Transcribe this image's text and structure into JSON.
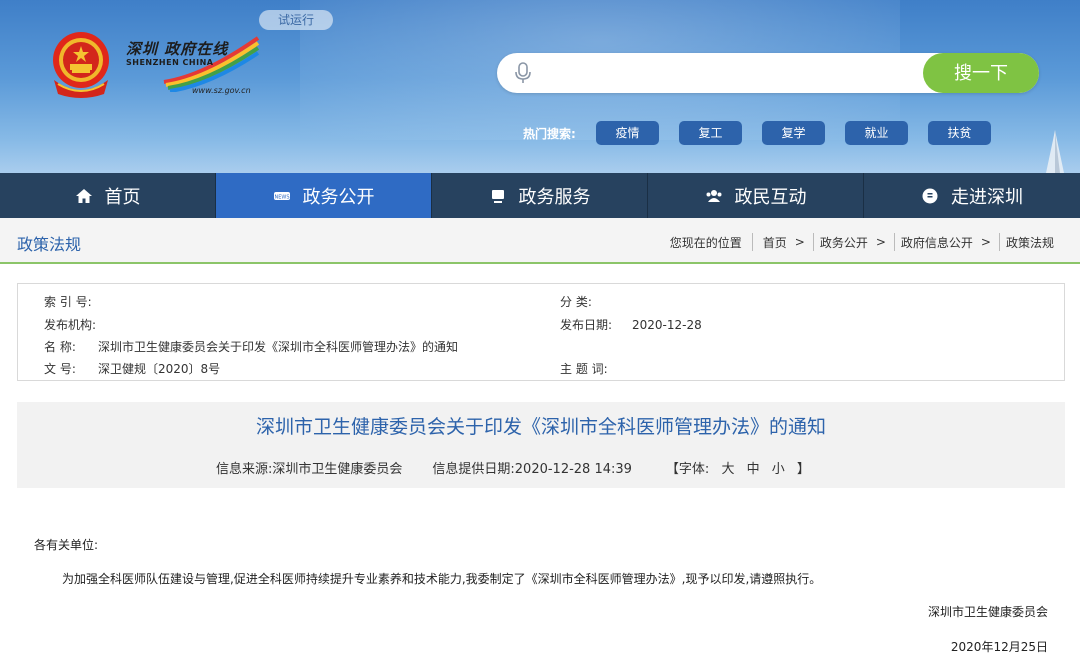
{
  "banner": {
    "trial_badge": "试运行",
    "logo_cn": "深圳 政府在线",
    "logo_en": "SHENZHEN CHINA",
    "logo_url": "www.sz.gov.cn",
    "search_placeholder": "",
    "search_button": "搜一下",
    "hot_label": "热门搜索:",
    "hot_tags": [
      "疫情",
      "复工",
      "复学",
      "就业",
      "扶贫"
    ]
  },
  "nav": {
    "items": [
      {
        "label": "首页",
        "icon": "home-icon"
      },
      {
        "label": "政务公开",
        "icon": "news-icon"
      },
      {
        "label": "政务服务",
        "icon": "monitor-icon"
      },
      {
        "label": "政民互动",
        "icon": "people-icon"
      },
      {
        "label": "走进深圳",
        "icon": "city-icon"
      }
    ],
    "active_index": 1
  },
  "crumbbar": {
    "section_title": "政策法规",
    "location_label": "您现在的位置",
    "crumbs": [
      "首页",
      "政务公开",
      "政府信息公开",
      "政策法规"
    ]
  },
  "info": {
    "index_label": "索 引 号:",
    "index_value": "",
    "category_label": "分 类:",
    "category_value": "",
    "publisher_label": "发布机构:",
    "publisher_value": "",
    "date_label": "发布日期:",
    "date_value": "2020-12-28",
    "name_label": "名 称:",
    "name_value": "深圳市卫生健康委员会关于印发《深圳市全科医师管理办法》的通知",
    "docno_label": "文 号:",
    "docno_value": "深卫健规〔2020〕8号",
    "keyword_label": "主 题 词:",
    "keyword_value": ""
  },
  "article": {
    "title": "深圳市卫生健康委员会关于印发《深圳市全科医师管理办法》的通知",
    "source": "信息来源:深圳市卫生健康委员会",
    "provided_date": "信息提供日期:2020-12-28 14:39",
    "font_open": "【字体:",
    "font_large": "大",
    "font_medium": "中",
    "font_small": "小",
    "font_close": "】",
    "greeting": "各有关单位:",
    "paragraph": "为加强全科医师队伍建设与管理,促进全科医师持续提升专业素养和技术能力,我委制定了《深圳市全科医师管理办法》,现予以印发,请遵照执行。",
    "signature": "深圳市卫生健康委员会",
    "date": "2020年12月25日"
  },
  "colors": {
    "nav_bg": "#27425f",
    "nav_active": "#2f6bc4",
    "accent_blue": "#2d63ab",
    "search_green": "#7fc343",
    "divider_green": "#8cc569"
  }
}
